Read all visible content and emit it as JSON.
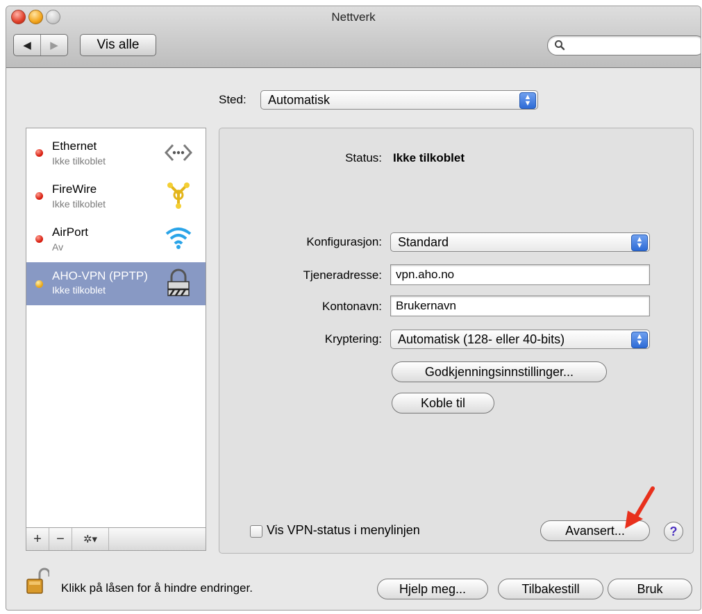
{
  "window": {
    "title": "Nettverk"
  },
  "toolbar": {
    "back_glyph": "◀",
    "forward_glyph": "▶",
    "show_all_label": "Vis alle",
    "search_placeholder": ""
  },
  "location": {
    "label": "Sted:",
    "value": "Automatisk"
  },
  "services": [
    {
      "name": "Ethernet",
      "status": "Ikke tilkoblet",
      "indicator": "#d61a0c",
      "icon": "ethernet-icon"
    },
    {
      "name": "FireWire",
      "status": "Ikke tilkoblet",
      "indicator": "#d61a0c",
      "icon": "firewire-icon"
    },
    {
      "name": "AirPort",
      "status": "Av",
      "indicator": "#d61a0c",
      "icon": "wifi-icon"
    },
    {
      "name": "AHO-VPN (PPTP)",
      "status": "Ikke tilkoblet",
      "indicator": "#e9a515",
      "icon": "vpn-lock-icon",
      "selected": true
    }
  ],
  "sidebar_toolbar": {
    "add": "+",
    "remove": "−",
    "action": "✲▾"
  },
  "detail": {
    "status_label": "Status:",
    "status_value": "Ikke tilkoblet",
    "config_label": "Konfigurasjon:",
    "config_value": "Standard",
    "server_label": "Tjeneradresse:",
    "server_value": "vpn.aho.no",
    "account_label": "Kontonavn:",
    "account_value": "Brukernavn",
    "encryption_label": "Kryptering:",
    "encryption_value": "Automatisk (128- eller 40-bits)",
    "auth_button": "Godkjenningsinnstillinger...",
    "connect_button": "Koble til",
    "show_status_label": "Vis VPN-status i menylinjen",
    "show_status_checked": false,
    "advanced_button": "Avansert...",
    "help_glyph": "?"
  },
  "footer": {
    "lock_text": "Klikk på låsen for å hindre endringer.",
    "assist_button": "Hjelp meg...",
    "revert_button": "Tilbakestill",
    "apply_button": "Bruk"
  },
  "colors": {
    "selection": "#8899c4",
    "annotation_arrow": "#e8301c"
  }
}
